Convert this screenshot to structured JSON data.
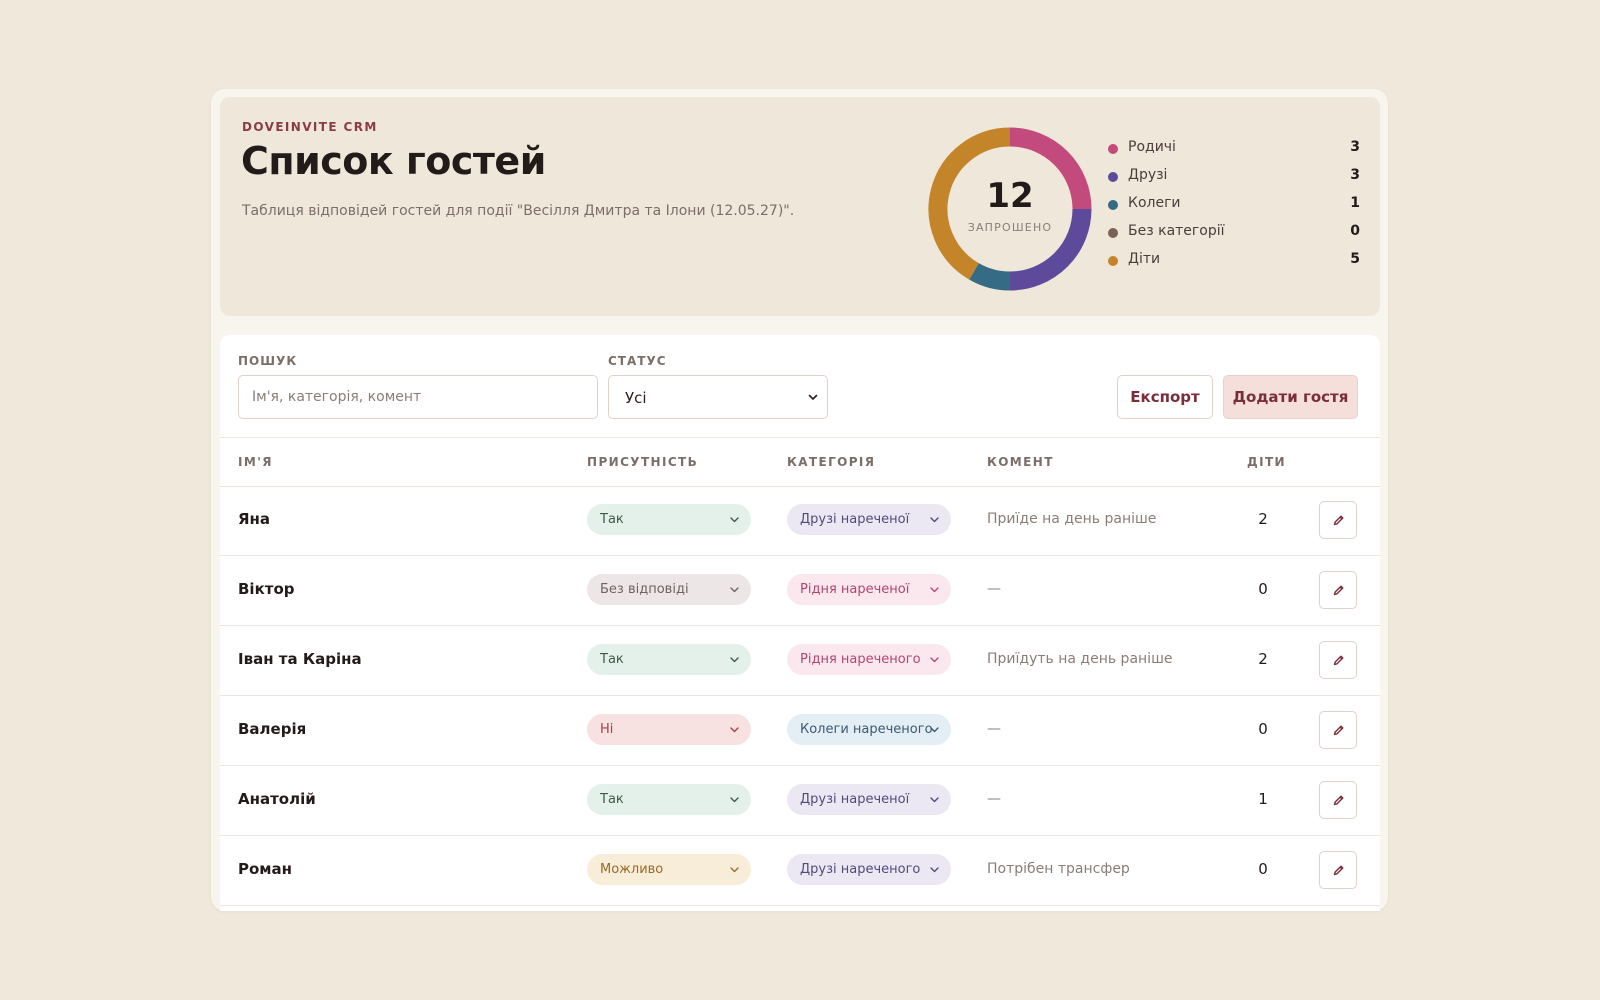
{
  "header": {
    "brand": "DOVEINVITE CRM",
    "title": "Список гостей",
    "subtitle": "Таблиця відповідей гостей для події \"Весілля Дмитра та Ілони (12.05.27)\"."
  },
  "summary": {
    "total": "12",
    "total_label": "ЗАПРОШЕНО",
    "legend": [
      {
        "label": "Родичі",
        "count": "3",
        "color": "#c24a7c"
      },
      {
        "label": "Друзі",
        "count": "3",
        "color": "#5e4a9a"
      },
      {
        "label": "Колеги",
        "count": "1",
        "color": "#356b84"
      },
      {
        "label": "Без категорії",
        "count": "0",
        "color": "#7a6156"
      },
      {
        "label": "Діти",
        "count": "5",
        "color": "#c4842a"
      }
    ]
  },
  "filters": {
    "search_label": "ПОШУК",
    "search_placeholder": "Ім'я, категорія, комент",
    "status_label": "СТАТУС",
    "status_value": "Усі",
    "export_label": "Експорт",
    "add_label": "Додати гостя"
  },
  "table": {
    "columns": {
      "name": "ІМ'Я",
      "attendance": "ПРИСУТНІСТЬ",
      "category": "КАТЕГОРІЯ",
      "comment": "КОМЕНТ",
      "kids": "ДІТИ"
    },
    "rows": [
      {
        "name": "Яна",
        "attendance": "Так",
        "attendance_tone": "yes",
        "category": "Друзі нареченої",
        "category_tone": "friends",
        "comment": "Приїде на день раніше",
        "kids": "2"
      },
      {
        "name": "Віктор",
        "attendance": "Без відповіді",
        "attendance_tone": "none",
        "category": "Рідня нареченої",
        "category_tone": "family",
        "comment": "—",
        "kids": "0"
      },
      {
        "name": "Іван та Каріна",
        "attendance": "Так",
        "attendance_tone": "yes",
        "category": "Рідня нареченого",
        "category_tone": "family",
        "comment": "Приїдуть на день раніше",
        "kids": "2"
      },
      {
        "name": "Валерія",
        "attendance": "Ні",
        "attendance_tone": "no",
        "category": "Колеги нареченого",
        "category_tone": "colleagues",
        "comment": "—",
        "kids": "0"
      },
      {
        "name": "Анатолій",
        "attendance": "Так",
        "attendance_tone": "yes",
        "category": "Друзі нареченої",
        "category_tone": "friends",
        "comment": "—",
        "kids": "1"
      },
      {
        "name": "Роман",
        "attendance": "Можливо",
        "attendance_tone": "maybe",
        "category": "Друзі нареченого",
        "category_tone": "friends",
        "comment": "Потрібен трансфер",
        "kids": "0"
      }
    ]
  },
  "tones": {
    "yes": {
      "bg": "#e4f1ea",
      "fg": "#3f5a4a"
    },
    "none": {
      "bg": "#ede6e6",
      "fg": "#6f6262"
    },
    "no": {
      "bg": "#f7e1e1",
      "fg": "#a8404a"
    },
    "maybe": {
      "bg": "#f8edd9",
      "fg": "#9a6a28"
    },
    "friends": {
      "bg": "#ebe8f4",
      "fg": "#544a78"
    },
    "family": {
      "bg": "#fbe7ee",
      "fg": "#b24670"
    },
    "colleagues": {
      "bg": "#e4eef5",
      "fg": "#3a5a72"
    }
  }
}
